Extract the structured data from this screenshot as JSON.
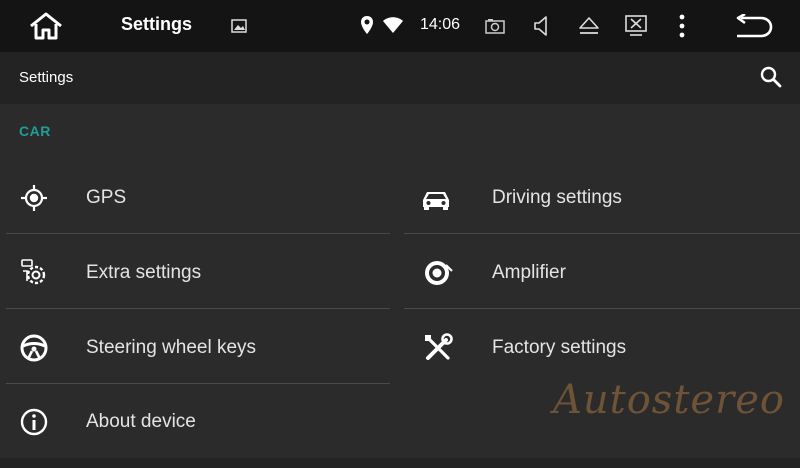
{
  "statusbar": {
    "title": "Settings",
    "time": "14:06"
  },
  "toolbar": {
    "title": "Settings"
  },
  "section": {
    "header": "CAR"
  },
  "tiles": [
    {
      "label": "GPS",
      "icon": "gps-icon"
    },
    {
      "label": "Driving settings",
      "icon": "car-icon"
    },
    {
      "label": "Extra settings",
      "icon": "extra-settings-icon"
    },
    {
      "label": "Amplifier",
      "icon": "amplifier-icon"
    },
    {
      "label": "Steering wheel keys",
      "icon": "steering-wheel-icon"
    },
    {
      "label": "Factory settings",
      "icon": "tools-icon"
    },
    {
      "label": "About device",
      "icon": "info-icon"
    }
  ],
  "watermark": "Autostereo",
  "colors": {
    "accent": "#1c9f95",
    "statusbar_bg": "#141414",
    "toolbar_bg": "#232323",
    "content_bg": "#2b2b2b"
  }
}
